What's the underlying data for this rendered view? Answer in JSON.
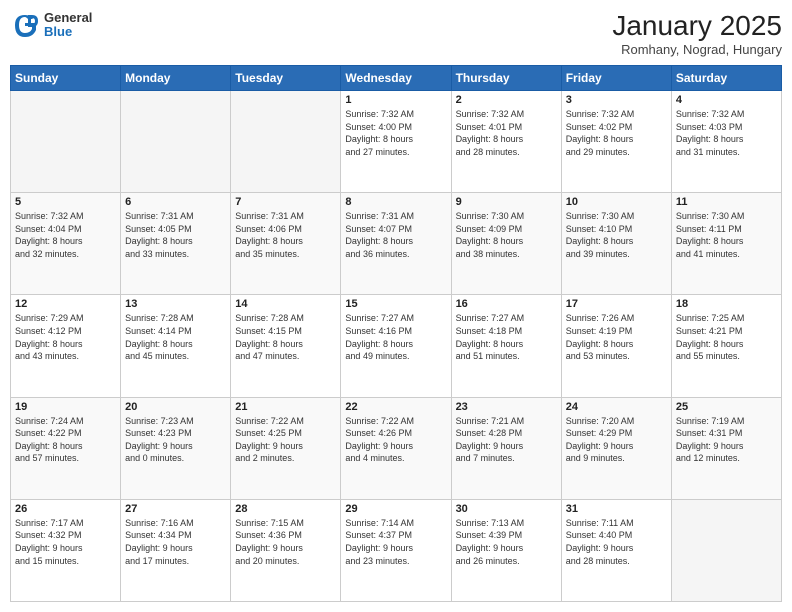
{
  "header": {
    "logo_general": "General",
    "logo_blue": "Blue",
    "month_title": "January 2025",
    "location": "Romhany, Nograd, Hungary"
  },
  "days_of_week": [
    "Sunday",
    "Monday",
    "Tuesday",
    "Wednesday",
    "Thursday",
    "Friday",
    "Saturday"
  ],
  "weeks": [
    [
      {
        "day": "",
        "info": ""
      },
      {
        "day": "",
        "info": ""
      },
      {
        "day": "",
        "info": ""
      },
      {
        "day": "1",
        "info": "Sunrise: 7:32 AM\nSunset: 4:00 PM\nDaylight: 8 hours\nand 27 minutes."
      },
      {
        "day": "2",
        "info": "Sunrise: 7:32 AM\nSunset: 4:01 PM\nDaylight: 8 hours\nand 28 minutes."
      },
      {
        "day": "3",
        "info": "Sunrise: 7:32 AM\nSunset: 4:02 PM\nDaylight: 8 hours\nand 29 minutes."
      },
      {
        "day": "4",
        "info": "Sunrise: 7:32 AM\nSunset: 4:03 PM\nDaylight: 8 hours\nand 31 minutes."
      }
    ],
    [
      {
        "day": "5",
        "info": "Sunrise: 7:32 AM\nSunset: 4:04 PM\nDaylight: 8 hours\nand 32 minutes."
      },
      {
        "day": "6",
        "info": "Sunrise: 7:31 AM\nSunset: 4:05 PM\nDaylight: 8 hours\nand 33 minutes."
      },
      {
        "day": "7",
        "info": "Sunrise: 7:31 AM\nSunset: 4:06 PM\nDaylight: 8 hours\nand 35 minutes."
      },
      {
        "day": "8",
        "info": "Sunrise: 7:31 AM\nSunset: 4:07 PM\nDaylight: 8 hours\nand 36 minutes."
      },
      {
        "day": "9",
        "info": "Sunrise: 7:30 AM\nSunset: 4:09 PM\nDaylight: 8 hours\nand 38 minutes."
      },
      {
        "day": "10",
        "info": "Sunrise: 7:30 AM\nSunset: 4:10 PM\nDaylight: 8 hours\nand 39 minutes."
      },
      {
        "day": "11",
        "info": "Sunrise: 7:30 AM\nSunset: 4:11 PM\nDaylight: 8 hours\nand 41 minutes."
      }
    ],
    [
      {
        "day": "12",
        "info": "Sunrise: 7:29 AM\nSunset: 4:12 PM\nDaylight: 8 hours\nand 43 minutes."
      },
      {
        "day": "13",
        "info": "Sunrise: 7:28 AM\nSunset: 4:14 PM\nDaylight: 8 hours\nand 45 minutes."
      },
      {
        "day": "14",
        "info": "Sunrise: 7:28 AM\nSunset: 4:15 PM\nDaylight: 8 hours\nand 47 minutes."
      },
      {
        "day": "15",
        "info": "Sunrise: 7:27 AM\nSunset: 4:16 PM\nDaylight: 8 hours\nand 49 minutes."
      },
      {
        "day": "16",
        "info": "Sunrise: 7:27 AM\nSunset: 4:18 PM\nDaylight: 8 hours\nand 51 minutes."
      },
      {
        "day": "17",
        "info": "Sunrise: 7:26 AM\nSunset: 4:19 PM\nDaylight: 8 hours\nand 53 minutes."
      },
      {
        "day": "18",
        "info": "Sunrise: 7:25 AM\nSunset: 4:21 PM\nDaylight: 8 hours\nand 55 minutes."
      }
    ],
    [
      {
        "day": "19",
        "info": "Sunrise: 7:24 AM\nSunset: 4:22 PM\nDaylight: 8 hours\nand 57 minutes."
      },
      {
        "day": "20",
        "info": "Sunrise: 7:23 AM\nSunset: 4:23 PM\nDaylight: 9 hours\nand 0 minutes."
      },
      {
        "day": "21",
        "info": "Sunrise: 7:22 AM\nSunset: 4:25 PM\nDaylight: 9 hours\nand 2 minutes."
      },
      {
        "day": "22",
        "info": "Sunrise: 7:22 AM\nSunset: 4:26 PM\nDaylight: 9 hours\nand 4 minutes."
      },
      {
        "day": "23",
        "info": "Sunrise: 7:21 AM\nSunset: 4:28 PM\nDaylight: 9 hours\nand 7 minutes."
      },
      {
        "day": "24",
        "info": "Sunrise: 7:20 AM\nSunset: 4:29 PM\nDaylight: 9 hours\nand 9 minutes."
      },
      {
        "day": "25",
        "info": "Sunrise: 7:19 AM\nSunset: 4:31 PM\nDaylight: 9 hours\nand 12 minutes."
      }
    ],
    [
      {
        "day": "26",
        "info": "Sunrise: 7:17 AM\nSunset: 4:32 PM\nDaylight: 9 hours\nand 15 minutes."
      },
      {
        "day": "27",
        "info": "Sunrise: 7:16 AM\nSunset: 4:34 PM\nDaylight: 9 hours\nand 17 minutes."
      },
      {
        "day": "28",
        "info": "Sunrise: 7:15 AM\nSunset: 4:36 PM\nDaylight: 9 hours\nand 20 minutes."
      },
      {
        "day": "29",
        "info": "Sunrise: 7:14 AM\nSunset: 4:37 PM\nDaylight: 9 hours\nand 23 minutes."
      },
      {
        "day": "30",
        "info": "Sunrise: 7:13 AM\nSunset: 4:39 PM\nDaylight: 9 hours\nand 26 minutes."
      },
      {
        "day": "31",
        "info": "Sunrise: 7:11 AM\nSunset: 4:40 PM\nDaylight: 9 hours\nand 28 minutes."
      },
      {
        "day": "",
        "info": ""
      }
    ]
  ]
}
